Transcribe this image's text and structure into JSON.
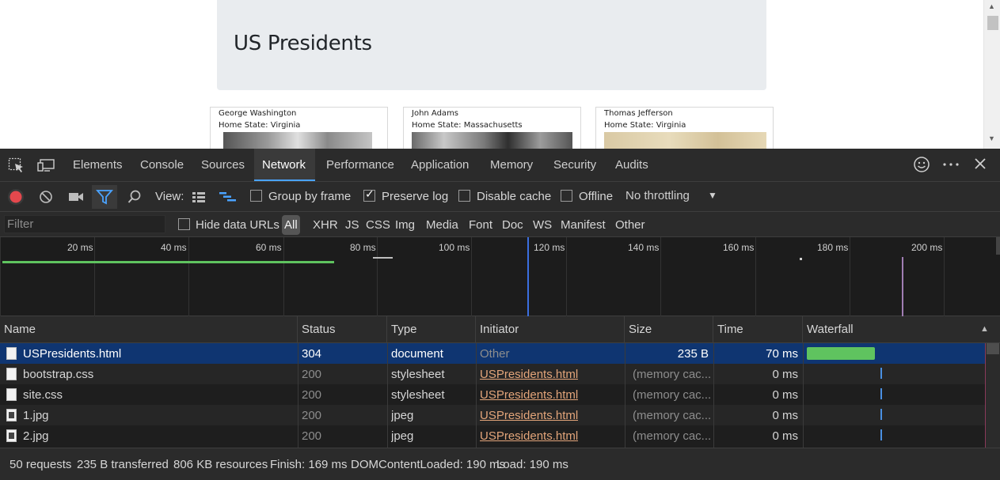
{
  "page": {
    "heading": "US Presidents",
    "cards": [
      {
        "name": "George Washington",
        "state": "Home State: Virginia"
      },
      {
        "name": "John Adams",
        "state": "Home State: Massachusetts"
      },
      {
        "name": "Thomas Jefferson",
        "state": "Home State: Virginia"
      }
    ]
  },
  "devtools": {
    "tabs": [
      "Elements",
      "Console",
      "Sources",
      "Network",
      "Performance",
      "Application",
      "Memory",
      "Security",
      "Audits"
    ],
    "active_tab": "Network",
    "toolbar": {
      "view_label": "View:",
      "group_by_frame": "Group by frame",
      "preserve_log": "Preserve log",
      "disable_cache": "Disable cache",
      "offline": "Offline",
      "throttling": "No throttling",
      "group_by_frame_checked": false,
      "preserve_log_checked": true,
      "disable_cache_checked": false,
      "offline_checked": false
    },
    "filter": {
      "placeholder": "Filter",
      "hide_data_urls": "Hide data URLs",
      "types": [
        "All",
        "XHR",
        "JS",
        "CSS",
        "Img",
        "Media",
        "Font",
        "Doc",
        "WS",
        "Manifest",
        "Other"
      ],
      "active_type": "All"
    },
    "overview": {
      "ticks": [
        "20 ms",
        "40 ms",
        "60 ms",
        "80 ms",
        "100 ms",
        "120 ms",
        "140 ms",
        "160 ms",
        "180 ms",
        "200 ms"
      ]
    },
    "columns": [
      "Name",
      "Status",
      "Type",
      "Initiator",
      "Size",
      "Time",
      "Waterfall"
    ],
    "requests": [
      {
        "name": "USPresidents.html",
        "status": "304",
        "type": "document",
        "initiator": "Other",
        "size": "235 B",
        "time": "70 ms"
      },
      {
        "name": "bootstrap.css",
        "status": "200",
        "type": "stylesheet",
        "initiator": "USPresidents.html",
        "size": "(memory cac...",
        "time": "0 ms"
      },
      {
        "name": "site.css",
        "status": "200",
        "type": "stylesheet",
        "initiator": "USPresidents.html",
        "size": "(memory cac...",
        "time": "0 ms"
      },
      {
        "name": "1.jpg",
        "status": "200",
        "type": "jpeg",
        "initiator": "USPresidents.html",
        "size": "(memory cac...",
        "time": "0 ms"
      },
      {
        "name": "2.jpg",
        "status": "200",
        "type": "jpeg",
        "initiator": "USPresidents.html",
        "size": "(memory cac...",
        "time": "0 ms"
      }
    ],
    "summary": {
      "requests": "50 requests",
      "transferred": "235 B transferred",
      "resources": "806 KB resources",
      "finish": "Finish: 169 ms",
      "domcontentloaded": "DOMContentLoaded: 190 ms",
      "load": "Load: 190 ms"
    },
    "colors": {
      "accent": "#4aa3ff",
      "record": "#e5484d",
      "waterfall_bar": "#5fc35f",
      "selected_row": "#0f3571",
      "link": "#e3a57a"
    }
  }
}
